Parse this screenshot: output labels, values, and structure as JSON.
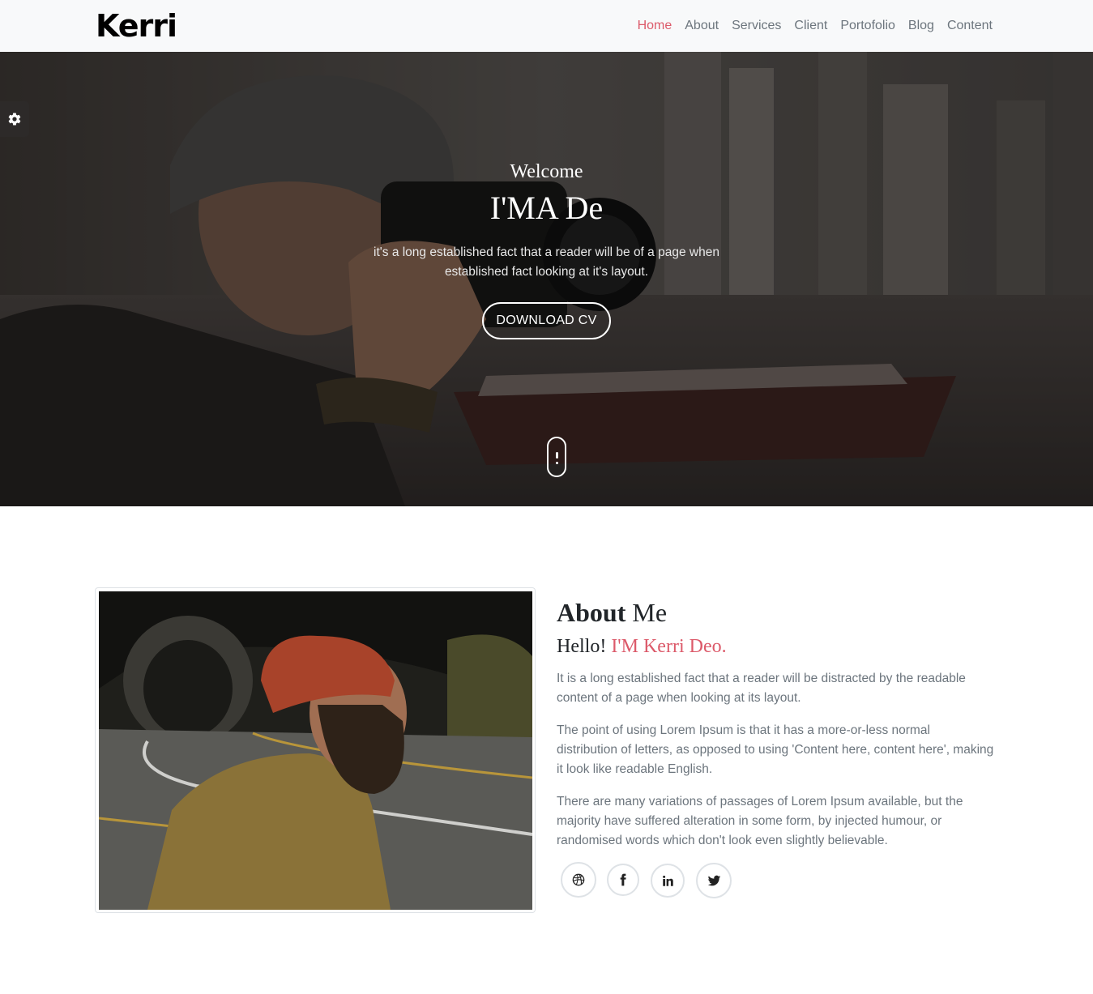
{
  "navbar": {
    "brand": "Kerri",
    "items": [
      {
        "label": "Home",
        "active": true
      },
      {
        "label": "About",
        "active": false
      },
      {
        "label": "Services",
        "active": false
      },
      {
        "label": "Client",
        "active": false
      },
      {
        "label": "Portofolio",
        "active": false
      },
      {
        "label": "Blog",
        "active": false
      },
      {
        "label": "Content",
        "active": false
      }
    ]
  },
  "hero": {
    "welcome": "Welcome",
    "title": "I'MA De",
    "text": "it's a long established fact that a reader will be of a page when established fact looking at it's layout.",
    "button_label": "DOWNLOAD CV"
  },
  "settings": {
    "icon": "gear-icon"
  },
  "about": {
    "heading_bold": "About",
    "heading_rest": " Me",
    "hello": "Hello! ",
    "name": "I'M Kerri Deo.",
    "paragraphs": [
      "It is a long established fact that a reader will be distracted by the readable content of a page when looking at its layout.",
      "The point of using Lorem Ipsum is that it has a more-or-less normal distribution of letters, as opposed to using 'Content here, content here', making it look like readable English.",
      "There are many variations of passages of Lorem Ipsum available, but the majority have suffered alteration in some form, by injected humour, or randomised words which don't look even slightly believable."
    ],
    "social": [
      "dribbble-icon",
      "facebook-icon",
      "linkedin-icon",
      "twitter-icon"
    ]
  },
  "colors": {
    "accent": "#dc5a6a",
    "nav_bg": "#f8f9fa",
    "text_muted": "#6c757d"
  }
}
